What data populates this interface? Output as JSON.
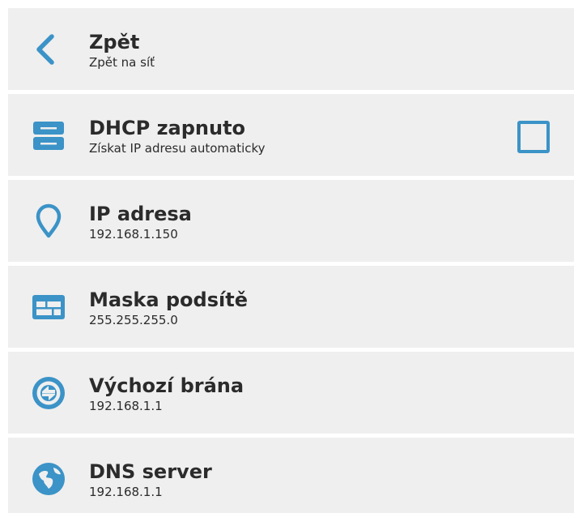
{
  "accent_color": "#3b93c7",
  "items": [
    {
      "icon": "back-arrow-icon",
      "title": "Zpět",
      "subtitle": "Zpět na síť"
    },
    {
      "icon": "dhcp-server-icon",
      "title": "DHCP zapnuto",
      "subtitle": "Získat IP adresu automaticky",
      "checked": false
    },
    {
      "icon": "location-pin-icon",
      "title": "IP adresa",
      "subtitle": "192.168.1.150"
    },
    {
      "icon": "subnet-mask-icon",
      "title": "Maska podsítě",
      "subtitle": "255.255.255.0"
    },
    {
      "icon": "gateway-icon",
      "title": "Výchozí brána",
      "subtitle": "192.168.1.1"
    },
    {
      "icon": "globe-icon",
      "title": "DNS server",
      "subtitle": "192.168.1.1"
    }
  ]
}
